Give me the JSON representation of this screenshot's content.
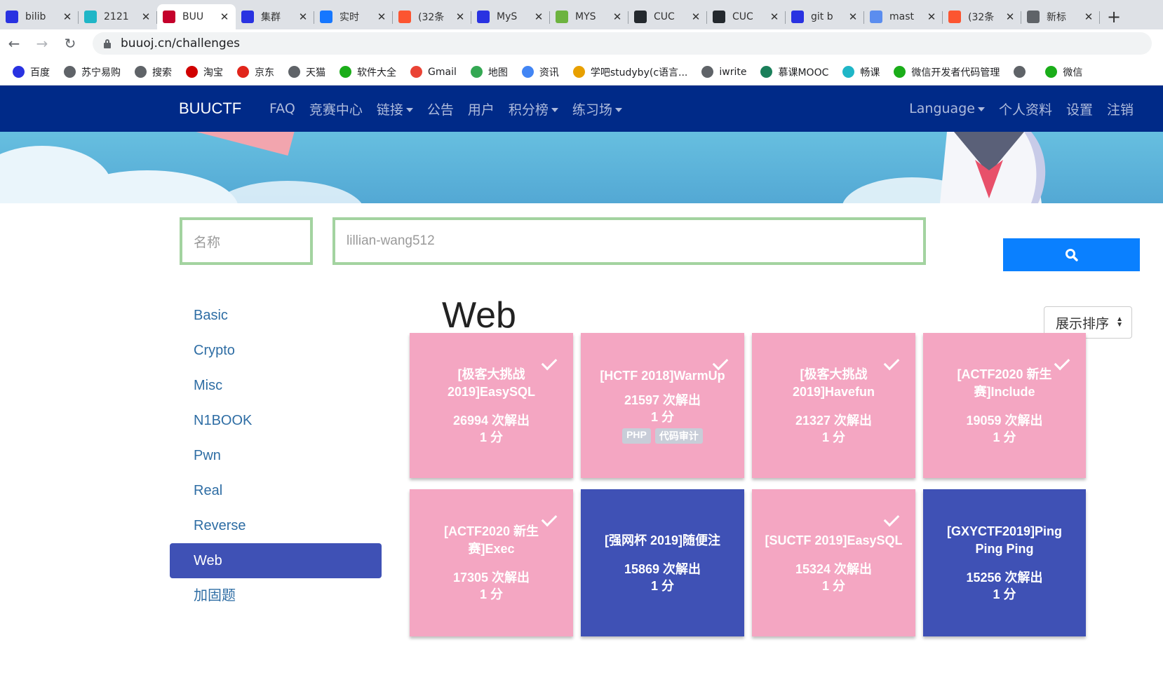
{
  "browser": {
    "tabs": [
      {
        "title": "bilib",
        "icon": "baidu-paw-icon",
        "color": "#2932e1"
      },
      {
        "title": "2121",
        "icon": "feather-icon",
        "color": "#1fb6c7"
      },
      {
        "title": "BUU",
        "icon": "buu-icon",
        "color": "#c4002b"
      },
      {
        "title": "集群",
        "icon": "baidu-paw-icon",
        "color": "#2932e1"
      },
      {
        "title": "实时",
        "icon": "people-icon",
        "color": "#1677ff"
      },
      {
        "title": "(32条",
        "icon": "csdn-icon",
        "color": "#fc5531"
      },
      {
        "title": "MyS",
        "icon": "baidu-paw-icon",
        "color": "#2932e1"
      },
      {
        "title": "MYS",
        "icon": "leaf-icon",
        "color": "#6db33f"
      },
      {
        "title": "CUC",
        "icon": "github-icon",
        "color": "#24292e"
      },
      {
        "title": "CUC",
        "icon": "github-icon",
        "color": "#24292e"
      },
      {
        "title": "git b",
        "icon": "baidu-paw-icon",
        "color": "#2932e1"
      },
      {
        "title": "mast",
        "icon": "elephant-icon",
        "color": "#5b8def"
      },
      {
        "title": "(32条",
        "icon": "csdn-icon",
        "color": "#fc5531"
      },
      {
        "title": "新标",
        "icon": "chrome-icon",
        "color": "#5f6368"
      }
    ],
    "active_tab": 2,
    "url": "buuoj.cn/challenges",
    "bookmarks": [
      {
        "label": "百度",
        "icon": "baidu-paw-icon",
        "color": "#2932e1"
      },
      {
        "label": "苏宁易购",
        "icon": "globe-icon",
        "color": "#5f6368"
      },
      {
        "label": "搜索",
        "icon": "globe-icon",
        "color": "#5f6368"
      },
      {
        "label": "淘宝",
        "icon": "taobao-icon",
        "color": "#d00000"
      },
      {
        "label": "京东",
        "icon": "jd-icon",
        "color": "#e1251b"
      },
      {
        "label": "天猫",
        "icon": "globe-icon",
        "color": "#5f6368"
      },
      {
        "label": "软件大全",
        "icon": "download-icon",
        "color": "#1aad19"
      },
      {
        "label": "Gmail",
        "icon": "gmail-icon",
        "color": "#ea4335"
      },
      {
        "label": "地图",
        "icon": "maps-icon",
        "color": "#34a853"
      },
      {
        "label": "资讯",
        "icon": "news-icon",
        "color": "#4285f4"
      },
      {
        "label": "学吧studyby(c语言...",
        "icon": "studyby-icon",
        "color": "#e8a000"
      },
      {
        "label": "iwrite",
        "icon": "globe-icon",
        "color": "#5f6368"
      },
      {
        "label": "慕课MOOC",
        "icon": "mooc-icon",
        "color": "#1a7f5a"
      },
      {
        "label": "畅课",
        "icon": "feather-icon",
        "color": "#1fb6c7"
      },
      {
        "label": "微信开发者代码管理",
        "icon": "wechat-icon",
        "color": "#1aad19"
      },
      {
        "label": "",
        "icon": "globe-icon",
        "color": "#5f6368"
      },
      {
        "label": "微信",
        "icon": "wechat-icon",
        "color": "#1aad19"
      }
    ]
  },
  "site": {
    "brand": "BUUCTF",
    "nav_left": [
      {
        "label": "FAQ",
        "dropdown": false
      },
      {
        "label": "竞赛中心",
        "dropdown": false
      },
      {
        "label": "链接",
        "dropdown": true
      },
      {
        "label": "公告",
        "dropdown": false
      },
      {
        "label": "用户",
        "dropdown": false
      },
      {
        "label": "积分榜",
        "dropdown": true
      },
      {
        "label": "练习场",
        "dropdown": true
      }
    ],
    "nav_right": [
      {
        "label": "Language",
        "dropdown": true
      },
      {
        "label": "个人资料",
        "dropdown": false
      },
      {
        "label": "设置",
        "dropdown": false
      },
      {
        "label": "注销",
        "dropdown": false
      }
    ],
    "navbar_color": "#002a88"
  },
  "search": {
    "name_placeholder": "名称",
    "query_value": "lillian-wang512",
    "button_icon": "search-icon"
  },
  "categories": [
    "Basic",
    "Crypto",
    "Misc",
    "N1BOOK",
    "Pwn",
    "Real",
    "Reverse",
    "Web",
    "加固题"
  ],
  "active_category": "Web",
  "main": {
    "title": "Web",
    "sort_label": "展示排序"
  },
  "challenges": [
    {
      "name": "[极客大挑战 2019]EasySQL",
      "solves": "26994 次解出",
      "points": "1 分",
      "solved": true,
      "tags": []
    },
    {
      "name": "[HCTF 2018]WarmUp",
      "solves": "21597 次解出",
      "points": "1 分",
      "solved": true,
      "tags": [
        "PHP",
        "代码审计"
      ]
    },
    {
      "name": "[极客大挑战 2019]Havefun",
      "solves": "21327 次解出",
      "points": "1 分",
      "solved": true,
      "tags": []
    },
    {
      "name": "[ACTF2020 新生赛]Include",
      "solves": "19059 次解出",
      "points": "1 分",
      "solved": true,
      "tags": []
    },
    {
      "name": "[ACTF2020 新生赛]Exec",
      "solves": "17305 次解出",
      "points": "1 分",
      "solved": true,
      "tags": []
    },
    {
      "name": "[强网杯 2019]随便注",
      "solves": "15869 次解出",
      "points": "1 分",
      "solved": false,
      "tags": []
    },
    {
      "name": "[SUCTF 2019]EasySQL",
      "solves": "15324 次解出",
      "points": "1 分",
      "solved": true,
      "tags": []
    },
    {
      "name": "[GXYCTF2019]Ping Ping Ping",
      "solves": "15256 次解出",
      "points": "1 分",
      "solved": false,
      "tags": []
    }
  ],
  "colors": {
    "solved": "#f4a6c2",
    "unsolved": "#3f51b5",
    "active_category": "#3f51b5",
    "search_button": "#0a80ff"
  }
}
